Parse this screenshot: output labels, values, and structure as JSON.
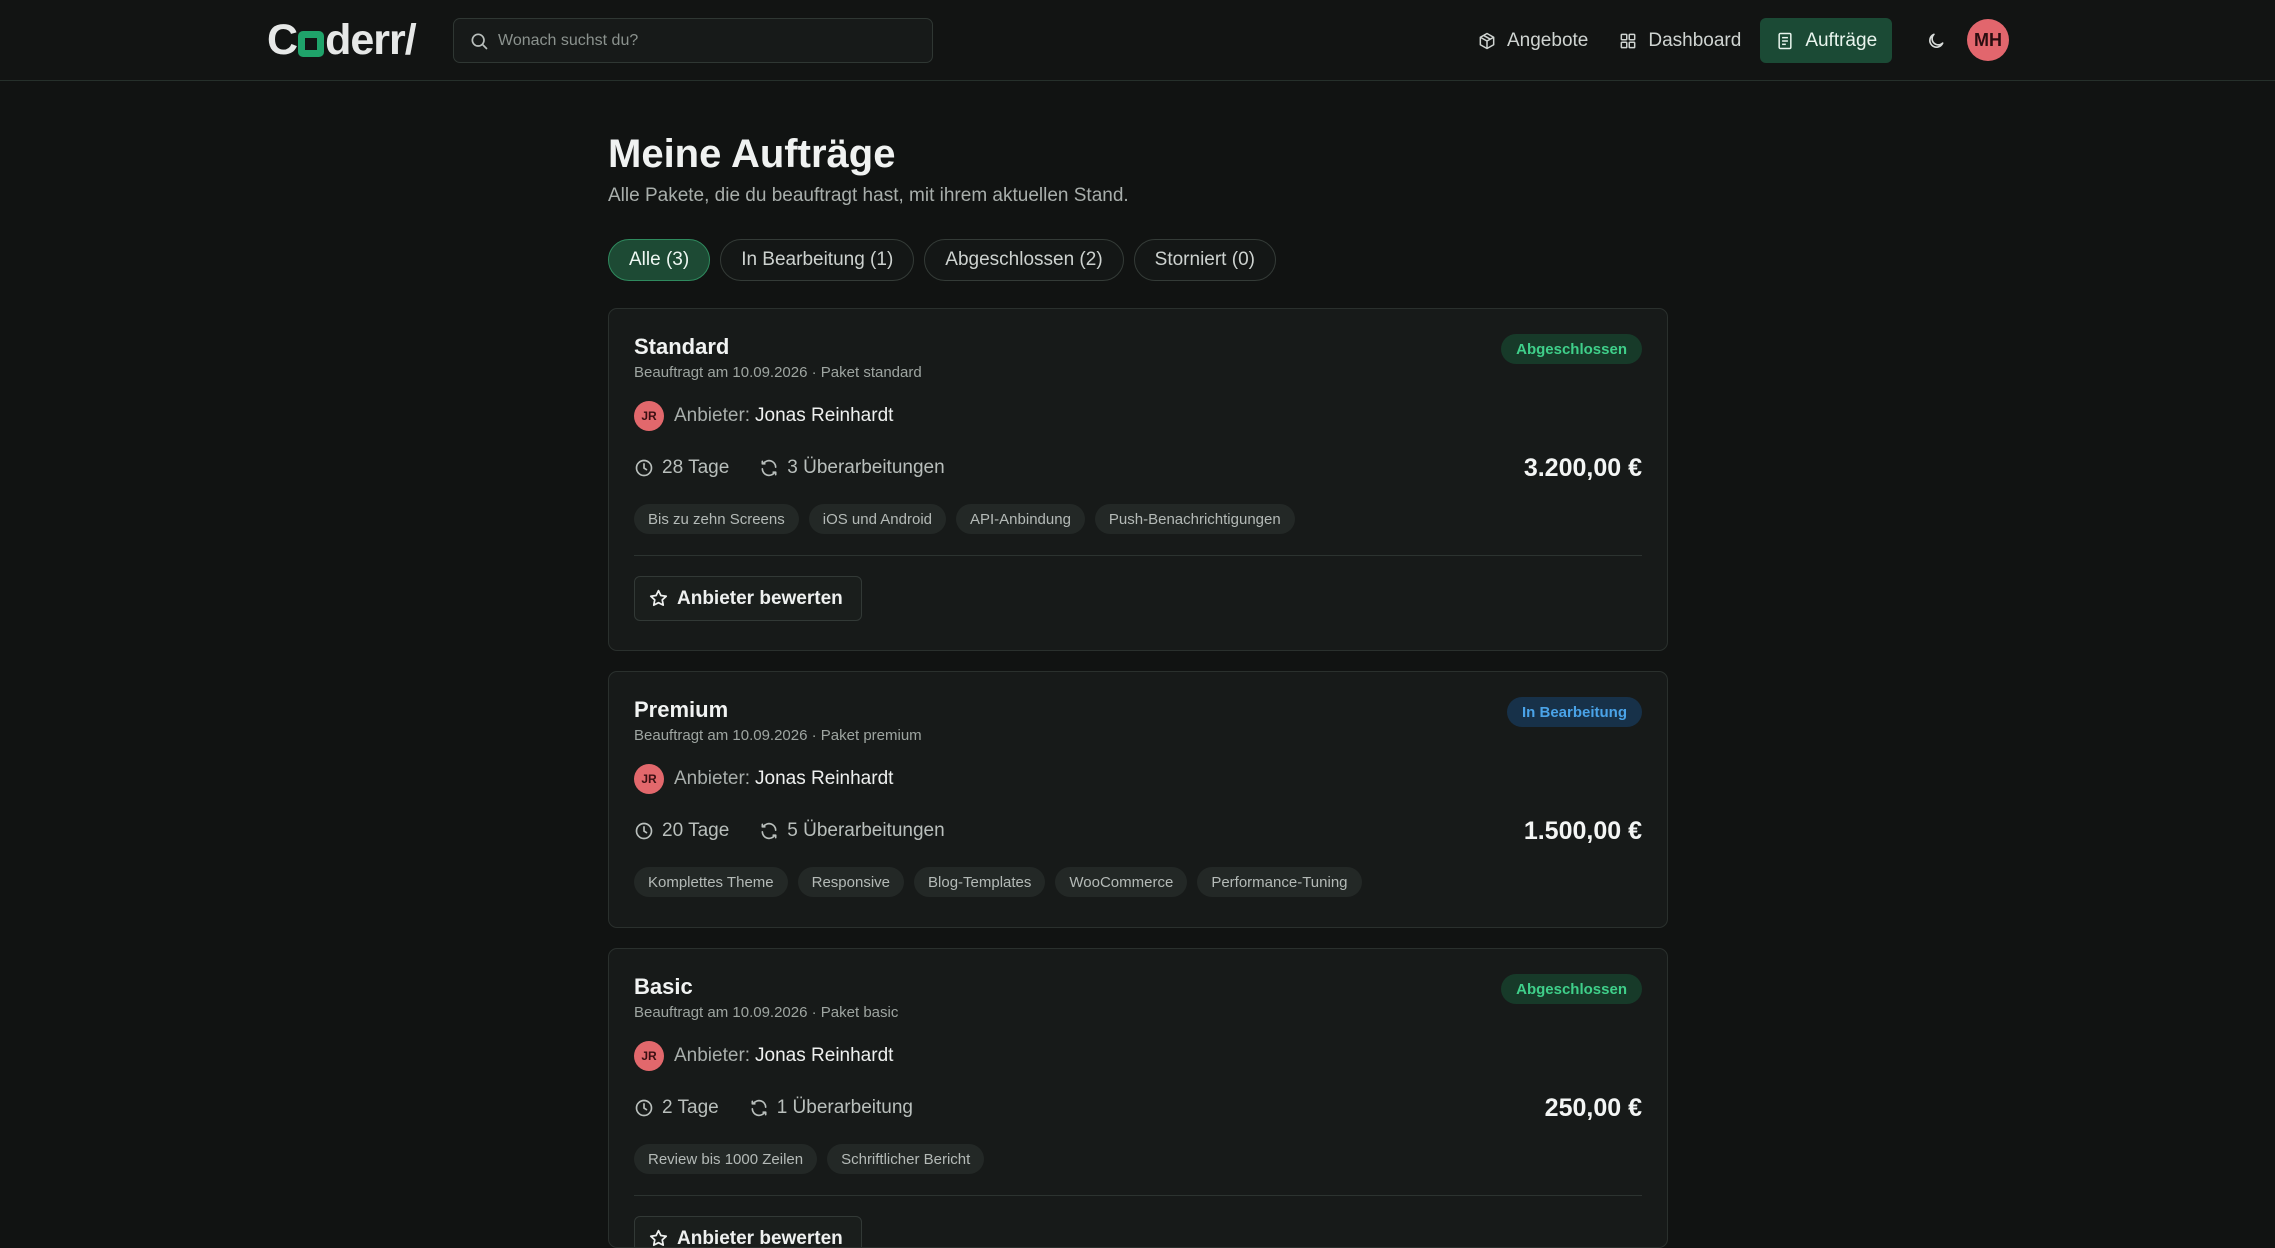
{
  "app": {
    "logo_text_pre": "C",
    "logo_text_post": "derr/"
  },
  "search": {
    "placeholder": "Wonach suchst du?"
  },
  "nav": {
    "items": [
      {
        "label": "Angebote",
        "icon": "package-icon",
        "active": false
      },
      {
        "label": "Dashboard",
        "icon": "dashboard-icon",
        "active": false
      },
      {
        "label": "Aufträge",
        "icon": "document-icon",
        "active": true
      }
    ],
    "user_initials": "MH"
  },
  "page": {
    "title": "Meine Aufträge",
    "subtitle": "Alle Pakete, die du beauftragt hast, mit ihrem aktuellen Stand."
  },
  "filters": [
    {
      "label": "Alle (3)",
      "active": true
    },
    {
      "label": "In Bearbeitung (1)",
      "active": false
    },
    {
      "label": "Abgeschlossen (2)",
      "active": false
    },
    {
      "label": "Storniert (0)",
      "active": false
    }
  ],
  "orders": [
    {
      "title": "Standard",
      "meta": "Beauftragt am 10.09.2026 · Paket standard",
      "status": "Abgeschlossen",
      "status_type": "done",
      "provider_initials": "JR",
      "provider_label": "Anbieter:",
      "provider_name": "Jonas Reinhardt",
      "duration": "28 Tage",
      "revisions": "3 Überarbeitungen",
      "price": "3.200,00 €",
      "tags": [
        "Bis zu zehn Screens",
        "iOS und Android",
        "API-Anbindung",
        "Push-Benachrichtigungen"
      ],
      "action": "Anbieter bewerten"
    },
    {
      "title": "Premium",
      "meta": "Beauftragt am 10.09.2026 · Paket premium",
      "status": "In Bearbeitung",
      "status_type": "progress",
      "provider_initials": "JR",
      "provider_label": "Anbieter:",
      "provider_name": "Jonas Reinhardt",
      "duration": "20 Tage",
      "revisions": "5 Überarbeitungen",
      "price": "1.500,00 €",
      "tags": [
        "Komplettes Theme",
        "Responsive",
        "Blog-Templates",
        "WooCommerce",
        "Performance-Tuning"
      ]
    },
    {
      "title": "Basic",
      "meta": "Beauftragt am 10.09.2026 · Paket basic",
      "status": "Abgeschlossen",
      "status_type": "done",
      "provider_initials": "JR",
      "provider_label": "Anbieter:",
      "provider_name": "Jonas Reinhardt",
      "duration": "2 Tage",
      "revisions": "1 Überarbeitung",
      "price": "250,00 €",
      "tags": [
        "Review bis 1000 Zeilen",
        "Schriftlicher Bericht"
      ],
      "action": "Anbieter bewerten"
    }
  ]
}
